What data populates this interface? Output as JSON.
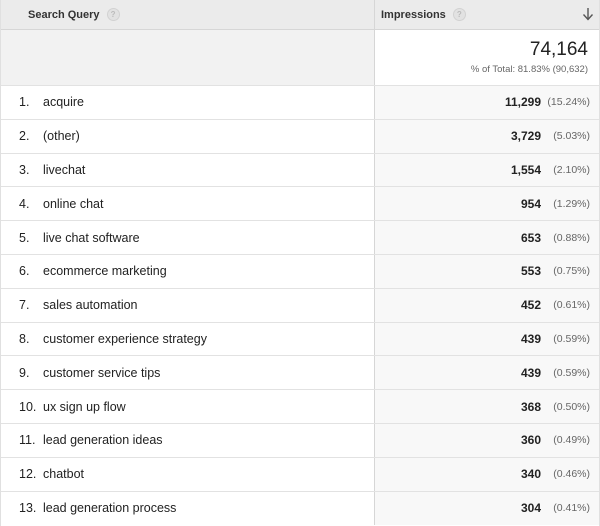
{
  "columns": {
    "query_label": "Search Query",
    "impressions_label": "Impressions"
  },
  "icons": {
    "help": "question-circle-icon",
    "sort": "arrow-down-icon"
  },
  "summary": {
    "total": "74,164",
    "pct_of_total": "% of Total: 81.83% (90,632)"
  },
  "rows": [
    {
      "index": "1.",
      "query": "acquire",
      "impressions": "11,299",
      "pct": "(15.24%)"
    },
    {
      "index": "2.",
      "query": "(other)",
      "impressions": "3,729",
      "pct": "(5.03%)"
    },
    {
      "index": "3.",
      "query": "livechat",
      "impressions": "1,554",
      "pct": "(2.10%)"
    },
    {
      "index": "4.",
      "query": "online chat",
      "impressions": "954",
      "pct": "(1.29%)"
    },
    {
      "index": "5.",
      "query": "live chat software",
      "impressions": "653",
      "pct": "(0.88%)"
    },
    {
      "index": "6.",
      "query": "ecommerce marketing",
      "impressions": "553",
      "pct": "(0.75%)"
    },
    {
      "index": "7.",
      "query": "sales automation",
      "impressions": "452",
      "pct": "(0.61%)"
    },
    {
      "index": "8.",
      "query": "customer experience strategy",
      "impressions": "439",
      "pct": "(0.59%)"
    },
    {
      "index": "9.",
      "query": "customer service tips",
      "impressions": "439",
      "pct": "(0.59%)"
    },
    {
      "index": "10.",
      "query": "ux sign up flow",
      "impressions": "368",
      "pct": "(0.50%)"
    },
    {
      "index": "11.",
      "query": "lead generation ideas",
      "impressions": "360",
      "pct": "(0.49%)"
    },
    {
      "index": "12.",
      "query": "chatbot",
      "impressions": "340",
      "pct": "(0.46%)"
    },
    {
      "index": "13.",
      "query": "lead generation process",
      "impressions": "304",
      "pct": "(0.41%)"
    }
  ]
}
